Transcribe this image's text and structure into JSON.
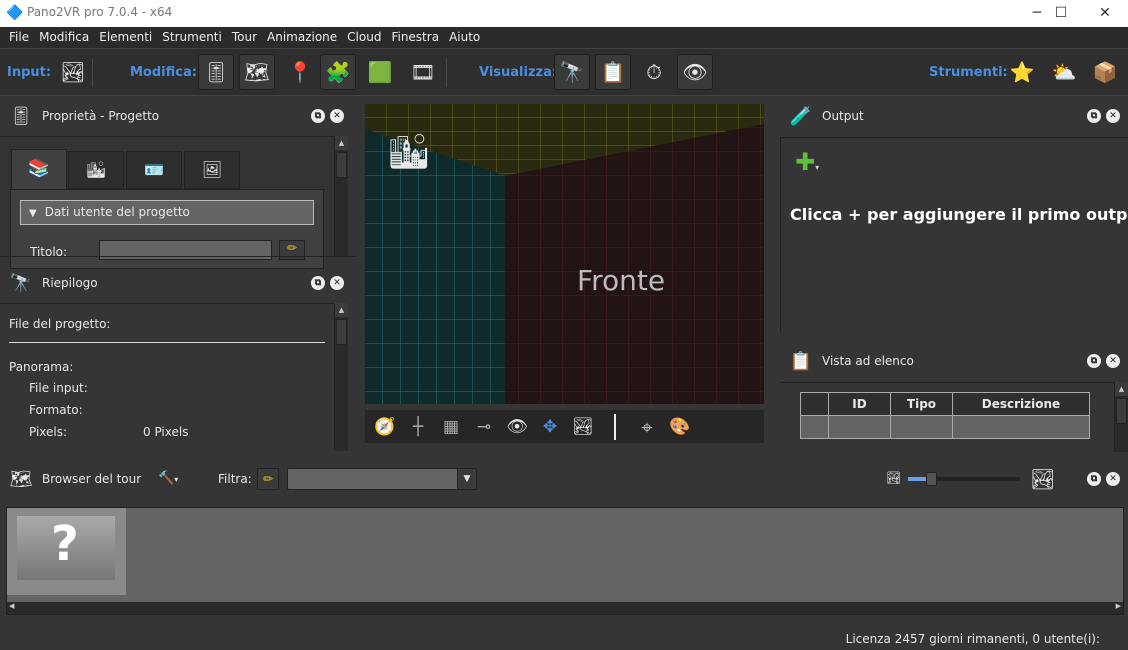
{
  "window": {
    "title": "Pano2VR pro 7.0.4 - x64",
    "minimize": "─",
    "maximize": "☐",
    "close": "✕"
  },
  "menu": [
    "File",
    "Modifica",
    "Elementi",
    "Strumenti",
    "Tour",
    "Animazione",
    "Cloud",
    "Finestra",
    "Aiuto"
  ],
  "toolbar": {
    "input_label": "Input:",
    "modifica_label": "Modifica:",
    "visualizza_label": "Visualizza:",
    "strumenti_label": "Strumenti:"
  },
  "properties": {
    "title": "Proprietà - Progetto",
    "section": "Dati utente del progetto",
    "titolo_label": "Titolo:",
    "titolo_value": ""
  },
  "summary": {
    "title": "Riepilogo",
    "project_file_label": "File del progetto:",
    "panorama_label": "Panorama:",
    "file_input_label": "File input:",
    "format_label": "Formato:",
    "pixels_label": "Pixels:",
    "pixels_value": "0 Pixels"
  },
  "viewer": {
    "face_label": "Fronte"
  },
  "output": {
    "title": "Output",
    "empty_message": "Clicca + per aggiungere il primo output!"
  },
  "list_view": {
    "title": "Vista ad elenco",
    "columns": [
      "",
      "ID",
      "Tipo",
      "Descrizione"
    ]
  },
  "tour_browser": {
    "title": "Browser del tour",
    "filter_label": "Filtra:",
    "filter_value": "",
    "thumb_size": 0.2
  },
  "status": {
    "text": "Licenza 2457 giorni rimanenti, 0 utente(i):"
  },
  "colors": {
    "accent": "#4a90e2",
    "bg": "#353535"
  }
}
